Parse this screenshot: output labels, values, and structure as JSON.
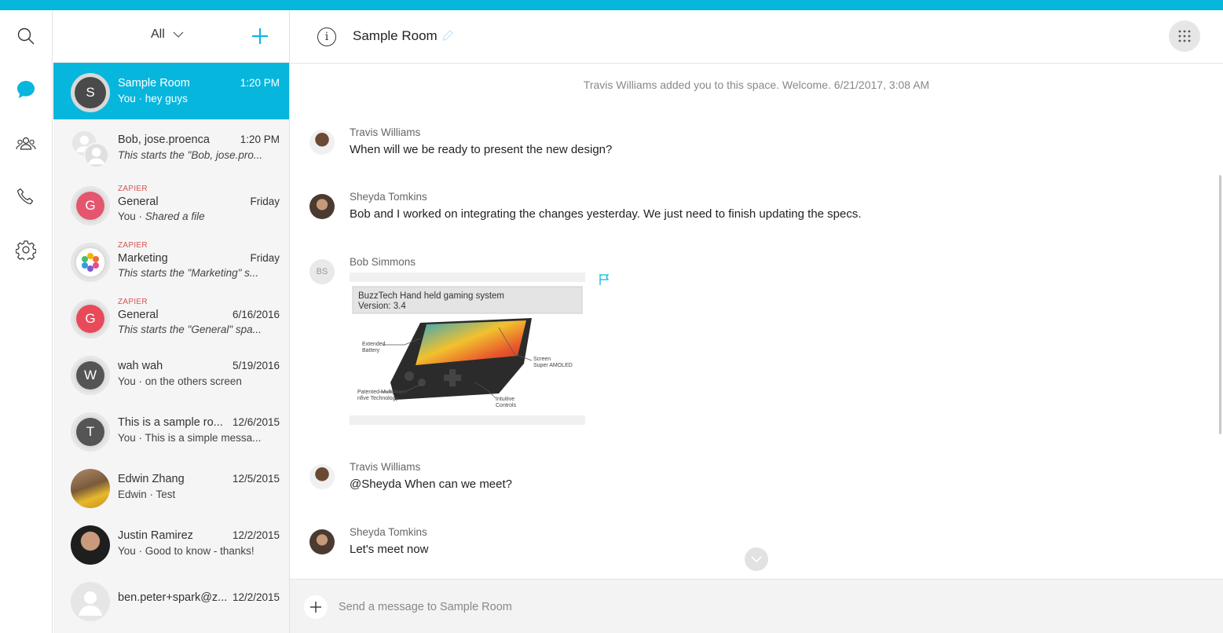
{
  "list": {
    "filter_label": "All",
    "items": [
      {
        "title": "Sample Room",
        "initial": "S",
        "time": "1:20 PM",
        "sub_prefix": "You · ",
        "sub_text": "hey guys",
        "italic": false
      },
      {
        "title": "Bob, jose.proenca",
        "time": "1:20 PM",
        "sub_prefix": "",
        "sub_text": "This starts the \"Bob, jose.pro...",
        "italic": true
      },
      {
        "team": "ZAPIER",
        "title": "General",
        "initial": "G",
        "time": "Friday",
        "sub_prefix": "You · ",
        "sub_text": "Shared a file",
        "italic": true,
        "color": "#e4566f"
      },
      {
        "team": "ZAPIER",
        "title": "Marketing",
        "time": "Friday",
        "sub_prefix": "",
        "sub_text": "This starts the \"Marketing\" s...",
        "italic": true
      },
      {
        "team": "ZAPIER",
        "title": "General",
        "initial": "G",
        "time": "6/16/2016",
        "sub_prefix": "",
        "sub_text": "This starts the \"General\" spa...",
        "italic": true,
        "color": "#e84a5a"
      },
      {
        "title": "wah wah",
        "initial": "W",
        "time": "5/19/2016",
        "sub_prefix": "You · ",
        "sub_text": "on the others screen",
        "italic": false
      },
      {
        "title": "This is a sample ro...",
        "initial": "T",
        "time": "12/6/2015",
        "sub_prefix": "You · ",
        "sub_text": "This is a simple messa...",
        "italic": false
      },
      {
        "title": "Edwin Zhang",
        "time": "12/5/2015",
        "sub_prefix": "Edwin · ",
        "sub_text": "Test",
        "italic": false
      },
      {
        "title": "Justin Ramirez",
        "time": "12/2/2015",
        "sub_prefix": "You · ",
        "sub_text": "Good to know - thanks!",
        "italic": false
      },
      {
        "title": "ben.peter+spark@z...",
        "time": "12/2/2015",
        "sub_prefix": "",
        "sub_text": "",
        "italic": false
      }
    ]
  },
  "room": {
    "title": "Sample Room",
    "system_message": "Travis Williams added you to this space. Welcome.  6/21/2017, 3:08 AM"
  },
  "messages": [
    {
      "name": "Travis Williams",
      "text": "When will we be ready to present the new design?"
    },
    {
      "name": "Sheyda Tomkins",
      "text": "Bob and I worked on integrating the changes yesterday. We just need to finish updating the specs."
    },
    {
      "name": "Bob Simmons",
      "initials": "BS",
      "text": ""
    },
    {
      "name": "Travis Williams",
      "text": "@Sheyda When can we meet?"
    },
    {
      "name": "Sheyda Tomkins",
      "text": "Let's meet now"
    }
  ],
  "attachment": {
    "title": "BuzzTech Hand held gaming system",
    "version": "Version: 3.4",
    "labels": [
      "Extended",
      "Battery",
      "Screen",
      "Super AMOLED",
      "Patented Multiplayer",
      "nfive Technology",
      "Intuitive",
      "Controls"
    ]
  },
  "composer": {
    "placeholder": "Send a message to Sample Room"
  },
  "colors": {
    "accent": "#07b6dd",
    "team_label": "#d9534f"
  }
}
